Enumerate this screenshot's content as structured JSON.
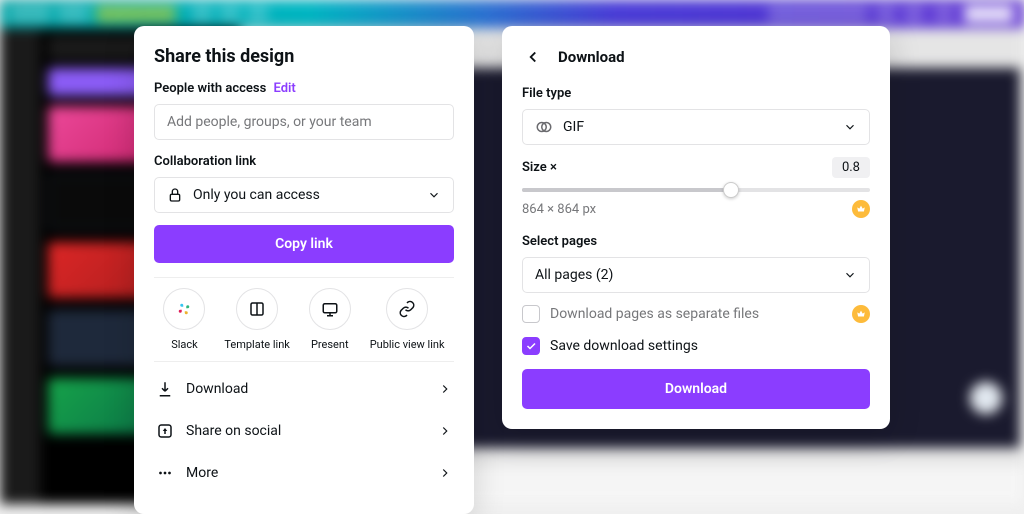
{
  "share": {
    "title": "Share this design",
    "access_label": "People with access",
    "edit_link": "Edit",
    "people_placeholder": "Add people, groups, or your team",
    "collab_label": "Collaboration link",
    "collab_value": "Only you can access",
    "copy_button": "Copy link",
    "icons": {
      "slack": "Slack",
      "template": "Template link",
      "present": "Present",
      "public": "Public view link"
    },
    "list": {
      "download": "Download",
      "social": "Share on social",
      "more": "More"
    }
  },
  "download": {
    "title": "Download",
    "file_type_label": "File type",
    "file_type_value": "GIF",
    "size_label": "Size ×",
    "size_value": "0.8",
    "dimensions": "864 × 864 px",
    "pages_label": "Select pages",
    "pages_value": "All pages (2)",
    "separate_files": "Download pages as separate files",
    "save_settings": "Save download settings",
    "button": "Download"
  }
}
